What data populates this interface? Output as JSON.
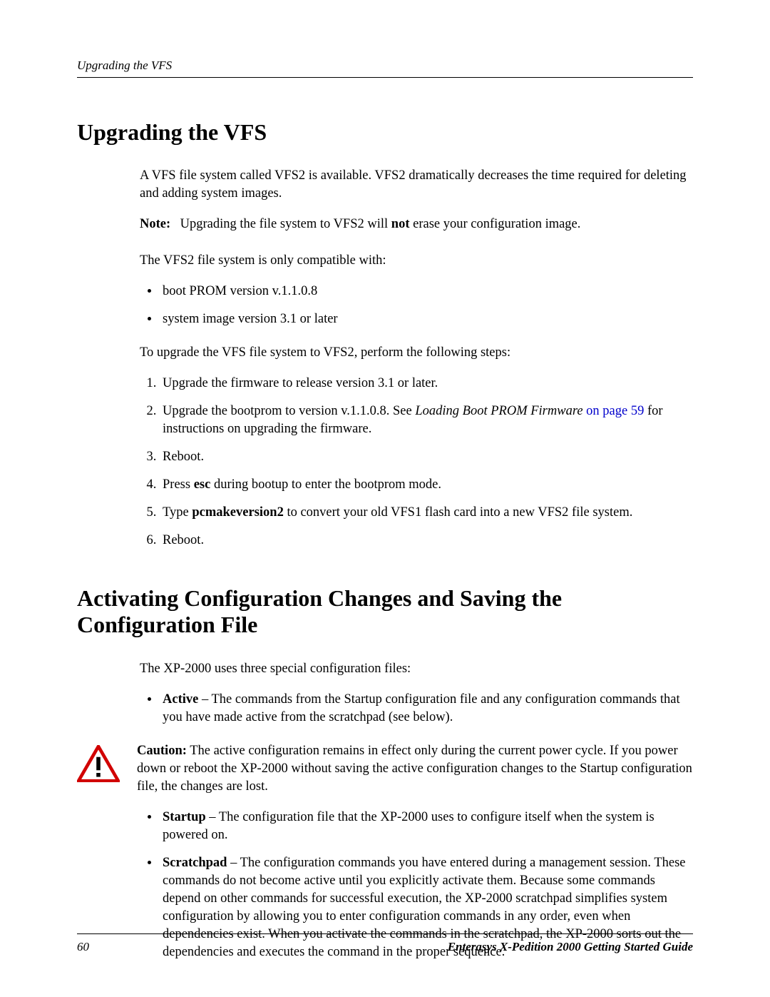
{
  "header": {
    "running": "Upgrading the VFS"
  },
  "section1": {
    "title": "Upgrading the VFS",
    "intro": "A VFS file system called VFS2 is available. VFS2 dramatically decreases the time required for deleting and adding system images.",
    "note_label": "Note:",
    "note_pre": "Upgrading the file system to VFS2 will ",
    "note_bold": "not",
    "note_post": " erase your configuration image.",
    "compat_intro": "The VFS2 file system is only compatible with:",
    "compat": [
      "boot PROM version v.1.1.0.8",
      "system image version 3.1 or later"
    ],
    "steps_intro": "To upgrade the VFS file system to VFS2, perform the following steps:",
    "step1": "Upgrade the firmware to release version 3.1 or later.",
    "step2_pre": "Upgrade the bootprom to version v.1.1.0.8. See ",
    "step2_italic": "Loading Boot PROM Firmware",
    "step2_link": " on page 59",
    "step2_post": " for instructions on upgrading the firmware.",
    "step3": "Reboot.",
    "step4_pre": "Press ",
    "step4_bold": "esc",
    "step4_post": " during bootup to enter the bootprom mode.",
    "step5_pre": "Type ",
    "step5_bold": "pcmakeversion2",
    "step5_post": " to convert your old VFS1 flash card into a new VFS2 file system.",
    "step6": "Reboot."
  },
  "section2": {
    "title": "Activating Configuration Changes and Saving the Configuration File",
    "intro": "The XP-2000 uses three special configuration files:",
    "active_label": "Active",
    "active_text": " – The commands from the Startup configuration file and any configuration commands that you have made active from the scratchpad (see below).",
    "caution_label": "Caution:",
    "caution_text": " The active configuration remains in effect only during the current power cycle. If you power down or reboot the XP-2000 without saving the active configuration changes to the Startup configuration file, the changes are lost.",
    "startup_label": "Startup",
    "startup_text": " – The configuration file that the XP-2000 uses to configure itself when the system is powered on.",
    "scratch_label": "Scratchpad",
    "scratch_text": " – The configuration commands you have entered during a management session. These commands do not become active until you explicitly activate them. Because some commands depend on other commands for successful execution, the XP-2000 scratchpad simplifies system configuration by allowing you to enter configuration commands in any order, even when dependencies exist. When you activate the commands in the scratchpad, the XP-2000 sorts out the dependencies and executes the command in the proper sequence."
  },
  "footer": {
    "page": "60",
    "guide": "Enterasys X-Pedition 2000 Getting Started Guide"
  }
}
